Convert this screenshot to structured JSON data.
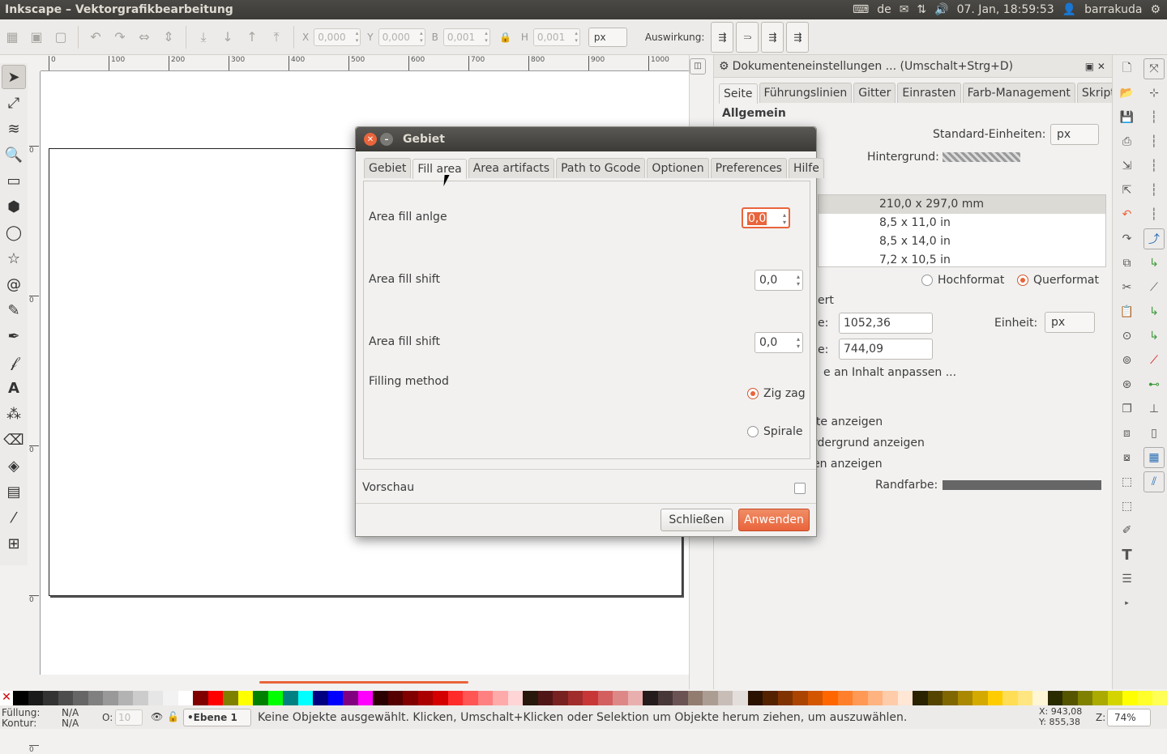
{
  "topbar": {
    "title": "Inkscape – Vektorgrafikbearbeitung",
    "keyboard_layout": "de",
    "datetime": "07. Jan, 18:59:53",
    "user": "barrakuda"
  },
  "toolbar": {
    "x_label": "X",
    "x_value": "0,000",
    "y_label": "Y",
    "y_value": "0,000",
    "w_label": "B",
    "w_value": "0,001",
    "h_label": "H",
    "h_value": "0,001",
    "unit": "px",
    "auswirkung_label": "Auswirkung:"
  },
  "ruler": {
    "top_ticks": [
      "0",
      "100",
      "200",
      "300",
      "400",
      "500",
      "600",
      "700",
      "800",
      "900",
      "1000"
    ],
    "left_ticks": [
      "0",
      "0",
      "0",
      "0",
      "0"
    ]
  },
  "docpanel": {
    "title": "Dokumenteneinstellungen ... (Umschalt+Strg+D)",
    "tabs": [
      "Seite",
      "Führungslinien",
      "Gitter",
      "Einrasten",
      "Farb-Management",
      "Skripte"
    ],
    "section_general": "Allgemein",
    "default_units_label": "Standard-Einheiten:",
    "default_units_value": "px",
    "background_label": "Hintergrund:",
    "sizes": [
      "210,0 x 297,0 mm",
      "8,5 x 11,0 in",
      "8,5 x 14,0 in",
      "7,2 x 10,5 in"
    ],
    "portrait": "Hochformat",
    "landscape": "Querformat",
    "custom_partial": "ert",
    "width_partial": "e:",
    "width_value": "1052,36",
    "height_partial": "e:",
    "height_value": "744,09",
    "unit_label": "Einheit:",
    "unit_value": "px",
    "fit_partial": "e an Inhalt anpassen ...",
    "show_border_partial": "ite anzeigen",
    "border_fg_partial": "rdergrund anzeigen",
    "shadow_partial": "en anzeigen",
    "border_color_label": "Randfarbe:"
  },
  "dialog": {
    "title": "Gebiet",
    "tabs": [
      "Gebiet",
      "Fill area",
      "Area artifacts",
      "Path to Gcode",
      "Optionen",
      "Preferences",
      "Hilfe"
    ],
    "fields": [
      {
        "label": "Area fill anlge",
        "value": "0,0"
      },
      {
        "label": "Area fill shift",
        "value": "0,0"
      },
      {
        "label": "Area fill shift",
        "value": "0,0"
      }
    ],
    "filling_method_label": "Filling method",
    "option_zigzag": "Zig zag",
    "option_spiral": "Spirale",
    "preview_label": "Vorschau",
    "close_button": "Schließen",
    "apply_button": "Anwenden"
  },
  "statusbar": {
    "fill_label": "Füllung:",
    "fill_value": "N/A",
    "stroke_label": "Kontur:",
    "stroke_value": "N/A",
    "opacity_label": "O:",
    "opacity_value": "10",
    "layer": "•Ebene 1",
    "message": "Keine Objekte ausgewählt. Klicken, Umschalt+Klicken oder Selektion um Objekte herum ziehen, um auszuwählen.",
    "x_coord": "X:  943,08",
    "y_coord": "Y:  855,38",
    "zoom_label": "Z:",
    "zoom_value": "74%"
  },
  "palette": [
    "#000000",
    "#1a1a1a",
    "#333333",
    "#4d4d4d",
    "#666666",
    "#808080",
    "#999999",
    "#b3b3b3",
    "#cccccc",
    "#e6e6e6",
    "#f2f2f2",
    "#ffffff",
    "#800000",
    "#ff0000",
    "#808000",
    "#ffff00",
    "#008000",
    "#00ff00",
    "#008080",
    "#00ffff",
    "#000080",
    "#0000ff",
    "#800080",
    "#ff00ff",
    "#2b0000",
    "#550000",
    "#800000",
    "#aa0000",
    "#d40000",
    "#ff2a2a",
    "#ff5555",
    "#ff8080",
    "#ffaaaa",
    "#ffd5d5",
    "#28170b",
    "#501616",
    "#782121",
    "#a02c2c",
    "#c83737",
    "#d35f5f",
    "#de8787",
    "#e9afaf",
    "#241c1c",
    "#483737",
    "#6c5353",
    "#917c6f",
    "#ac9d93",
    "#c8beb7",
    "#e3dedb",
    "#2b1100",
    "#552200",
    "#803300",
    "#aa4400",
    "#d45500",
    "#ff6600",
    "#ff7f2a",
    "#ff9955",
    "#ffb380",
    "#ffccaa",
    "#ffe6d5",
    "#2b2200",
    "#554400",
    "#806600",
    "#aa8800",
    "#d4aa00",
    "#ffcc00",
    "#ffdd55",
    "#ffe680",
    "#fff6d5",
    "#2b2b00",
    "#555500",
    "#808000",
    "#aaaa00",
    "#d4d400",
    "#ffff00",
    "#ffff2a",
    "#ffff55"
  ]
}
